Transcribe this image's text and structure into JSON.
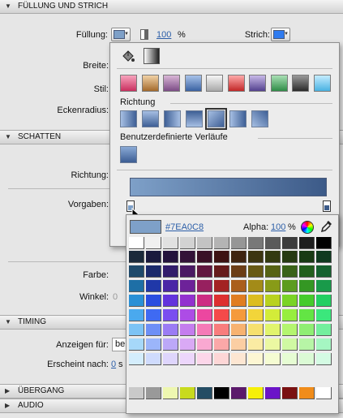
{
  "sections": {
    "fill_stroke": "FÜLLUNG UND STRICH",
    "shadow": "SCHATTEN",
    "timing": "TIMING",
    "transition": "ÜBERGANG",
    "audio": "AUDIO"
  },
  "fill_row": {
    "fill_label": "Füllung:",
    "fill_color": "#7EA0C8",
    "opacity_value": "100",
    "opacity_unit": "%",
    "stroke_label": "Strich:",
    "stroke_color": "#2f7bf0"
  },
  "background_labels": {
    "width": "Breite:",
    "style": "Stil:",
    "corner_radius": "Eckenradius:",
    "direction": "Richtung:",
    "presets": "Vorgaben:",
    "color": "Farbe:",
    "angle": "Winkel:",
    "angle_value": "0",
    "show_for": "Anzeigen für:",
    "show_for_value": "be",
    "appears_after": "Erscheint nach:",
    "appears_after_value": "0",
    "appears_after_unit": "s"
  },
  "gradient_panel": {
    "direction_label": "Richtung",
    "custom_label": "Benutzerdefinierte Verläufe",
    "preset_gradients": [
      [
        "#f7a3bd",
        "#c9305f"
      ],
      [
        "#f1d2a6",
        "#a46a2c"
      ],
      [
        "#d9b6d6",
        "#7c4c86"
      ],
      [
        "#a8c3ea",
        "#3a62a2"
      ],
      [
        "#f6f6f6",
        "#a9a9a9"
      ],
      [
        "#ffa9a9",
        "#c22727"
      ],
      [
        "#c8b9e8",
        "#53418f"
      ],
      [
        "#a9e0b5",
        "#2f8c47"
      ],
      [
        "#9a9a9a",
        "#2b2b2b"
      ],
      [
        "#c4ecff",
        "#49b2e2"
      ]
    ],
    "direction_count": 7,
    "selected_direction": 5,
    "bar_start": "#7EA0C8",
    "bar_end": "#3c5a88"
  },
  "picker": {
    "hex_value": "#7EA0C8",
    "alpha_label": "Alpha:",
    "alpha_value": "100",
    "alpha_unit": "%",
    "grayscale_row": [
      "#ffffff",
      "#f0f0f0",
      "#e1e1e1",
      "#d2d2d2",
      "#c3c3c3",
      "#b4b4b4",
      "#969696",
      "#787878",
      "#5a5a5a",
      "#3c3c3c",
      "#1e1e1e",
      "#000000"
    ],
    "grid_rows": [
      [
        "#1b2a3b",
        "#1a1a3d",
        "#24133d",
        "#331238",
        "#3a1026",
        "#3d1313",
        "#3f2410",
        "#3c3510",
        "#333a10",
        "#263a12",
        "#183a14",
        "#0f3a1f"
      ],
      [
        "#1f4a6b",
        "#1b2a6b",
        "#321d6b",
        "#4a1a63",
        "#611840",
        "#661c1c",
        "#6b3d16",
        "#675914",
        "#566214",
        "#3a6218",
        "#225f1d",
        "#15612f"
      ],
      [
        "#1e6fa6",
        "#2038a8",
        "#4a27a6",
        "#6d2299",
        "#97205f",
        "#a32323",
        "#aa5e1c",
        "#a38b18",
        "#889b18",
        "#5c9c1f",
        "#349723",
        "#199a4a"
      ],
      [
        "#2a90d6",
        "#2a4ee0",
        "#6334dc",
        "#9231cf",
        "#cd2c83",
        "#dd3030",
        "#e07d22",
        "#dcbd20",
        "#b9d21f",
        "#7ad326",
        "#45cb2c",
        "#22cf62"
      ],
      [
        "#4aa9ee",
        "#3f6af2",
        "#7a4ef0",
        "#ad4ce6",
        "#ec47a0",
        "#f44a4a",
        "#f59a3c",
        "#f2d53a",
        "#d3ec39",
        "#97ee3f",
        "#63e544",
        "#3be77c"
      ],
      [
        "#7cc3f5",
        "#6d8ff6",
        "#9b7cf4",
        "#c47dee",
        "#f57ab7",
        "#f87d7d",
        "#f7b270",
        "#f6e06f",
        "#e1f46d",
        "#b4f56f",
        "#8fee73",
        "#73ef9d"
      ],
      [
        "#a6d8f9",
        "#9bb5fa",
        "#bca8f8",
        "#d9a9f5",
        "#f9a8d1",
        "#fba8a8",
        "#fbcea3",
        "#faeba3",
        "#ebf8a2",
        "#d0f9a3",
        "#b7f5a6",
        "#a5f6c2"
      ],
      [
        "#d4edfc",
        "#cfdbfd",
        "#ded5fc",
        "#ecd6fb",
        "#fcd6e9",
        "#fdd6d6",
        "#fde6d2",
        "#fdf6d3",
        "#f5fcd2",
        "#e6fcd3",
        "#dbfad5",
        "#d4fbe3"
      ]
    ],
    "recent_colors": [
      "#c9c9c9",
      "#999999",
      "#eef7b0",
      "#c8da1e",
      "#254d64",
      "#000000",
      "#5b1a6b",
      "#f6f008",
      "#6b14c8",
      "#7a1111",
      "#f08c1a",
      "#ffffff"
    ]
  }
}
